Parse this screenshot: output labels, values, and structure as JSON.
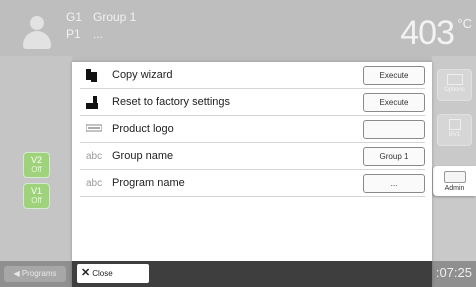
{
  "header": {
    "group_code": "G1",
    "group_name": "Group 1",
    "program_code": "P1",
    "program_name": "...",
    "temperature": "403",
    "temperature_unit": "°C"
  },
  "left_panel": {
    "v2_label": "V2",
    "v2_state": "Off",
    "v1_label": "V1",
    "v1_state": "Off"
  },
  "right_panel": {
    "options_label": "Options",
    "bv1_label": "BV1",
    "admin_label": "Admin"
  },
  "dialog": {
    "rows": [
      {
        "label": "Copy wizard",
        "icon": "copy-icon",
        "action": "Execute"
      },
      {
        "label": "Reset to factory settings",
        "icon": "reset-icon",
        "action": "Execute"
      },
      {
        "label": "Product logo",
        "icon": "logo-icon",
        "action": ""
      },
      {
        "label": "Group name",
        "icon": "text-icon",
        "action": "Group 1"
      },
      {
        "label": "Program name",
        "icon": "text-icon",
        "action": "..."
      }
    ],
    "close_label": "Close"
  },
  "bottom": {
    "programs_label": "Programs",
    "clock": ":07:25"
  },
  "icons": {
    "abc_glyph": "abc"
  }
}
